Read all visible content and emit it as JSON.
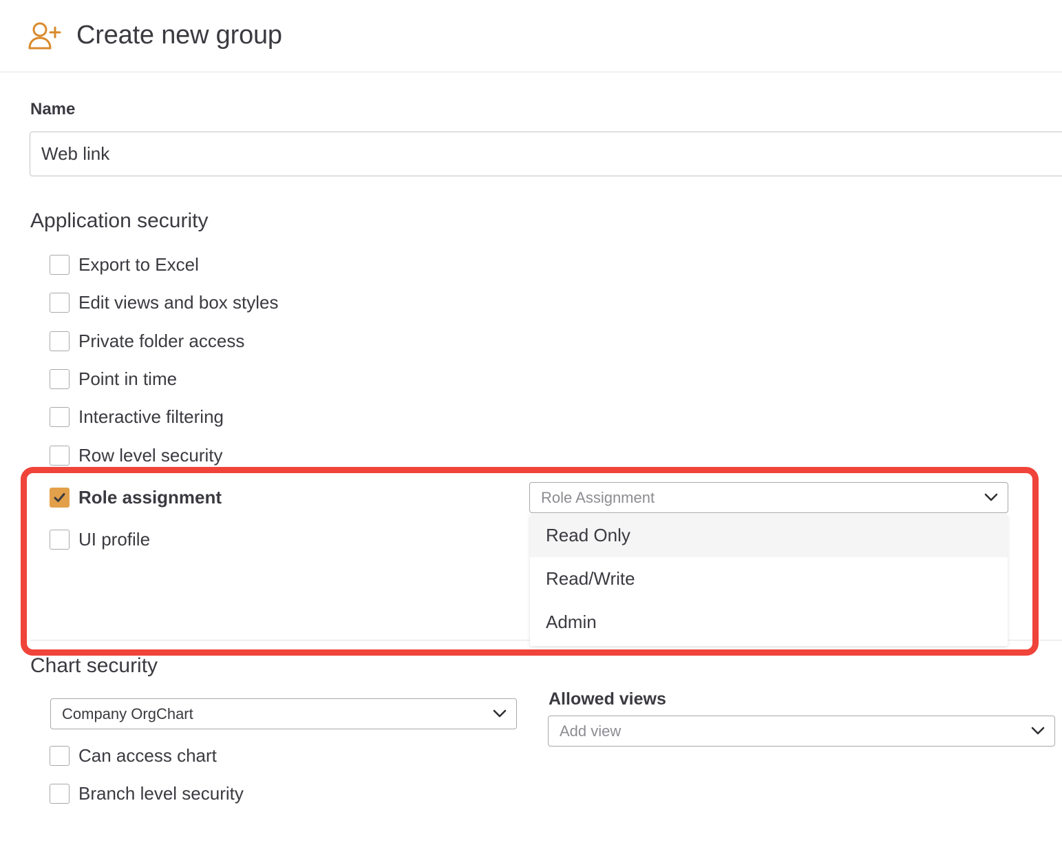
{
  "header": {
    "title": "Create new group",
    "icon": "add-user-icon",
    "accent_color": "#d98a2b"
  },
  "name_field": {
    "label": "Name",
    "value": "Web link"
  },
  "application_security": {
    "title": "Application security",
    "options": [
      {
        "label": "Export to Excel",
        "checked": false
      },
      {
        "label": "Edit views and box styles",
        "checked": false
      },
      {
        "label": "Private folder access",
        "checked": false
      },
      {
        "label": "Point in time",
        "checked": false
      },
      {
        "label": "Interactive filtering",
        "checked": false
      },
      {
        "label": "Row level security",
        "checked": false
      },
      {
        "label": "Role assignment",
        "checked": true
      },
      {
        "label": "UI profile",
        "checked": false
      }
    ],
    "role_select": {
      "placeholder": "Role Assignment",
      "options": [
        "Read Only",
        "Read/Write",
        "Admin"
      ],
      "hovered": "Read Only"
    }
  },
  "chart_security": {
    "title": "Chart security",
    "chart_select_value": "Company OrgChart",
    "options": [
      {
        "label": "Can access chart",
        "checked": false
      },
      {
        "label": "Branch level security",
        "checked": false
      }
    ],
    "allowed_views_label": "Allowed views",
    "allowed_views_placeholder": "Add view"
  },
  "colors": {
    "checkbox_checked": "#e2a04a",
    "highlight_border": "#f0433a"
  }
}
